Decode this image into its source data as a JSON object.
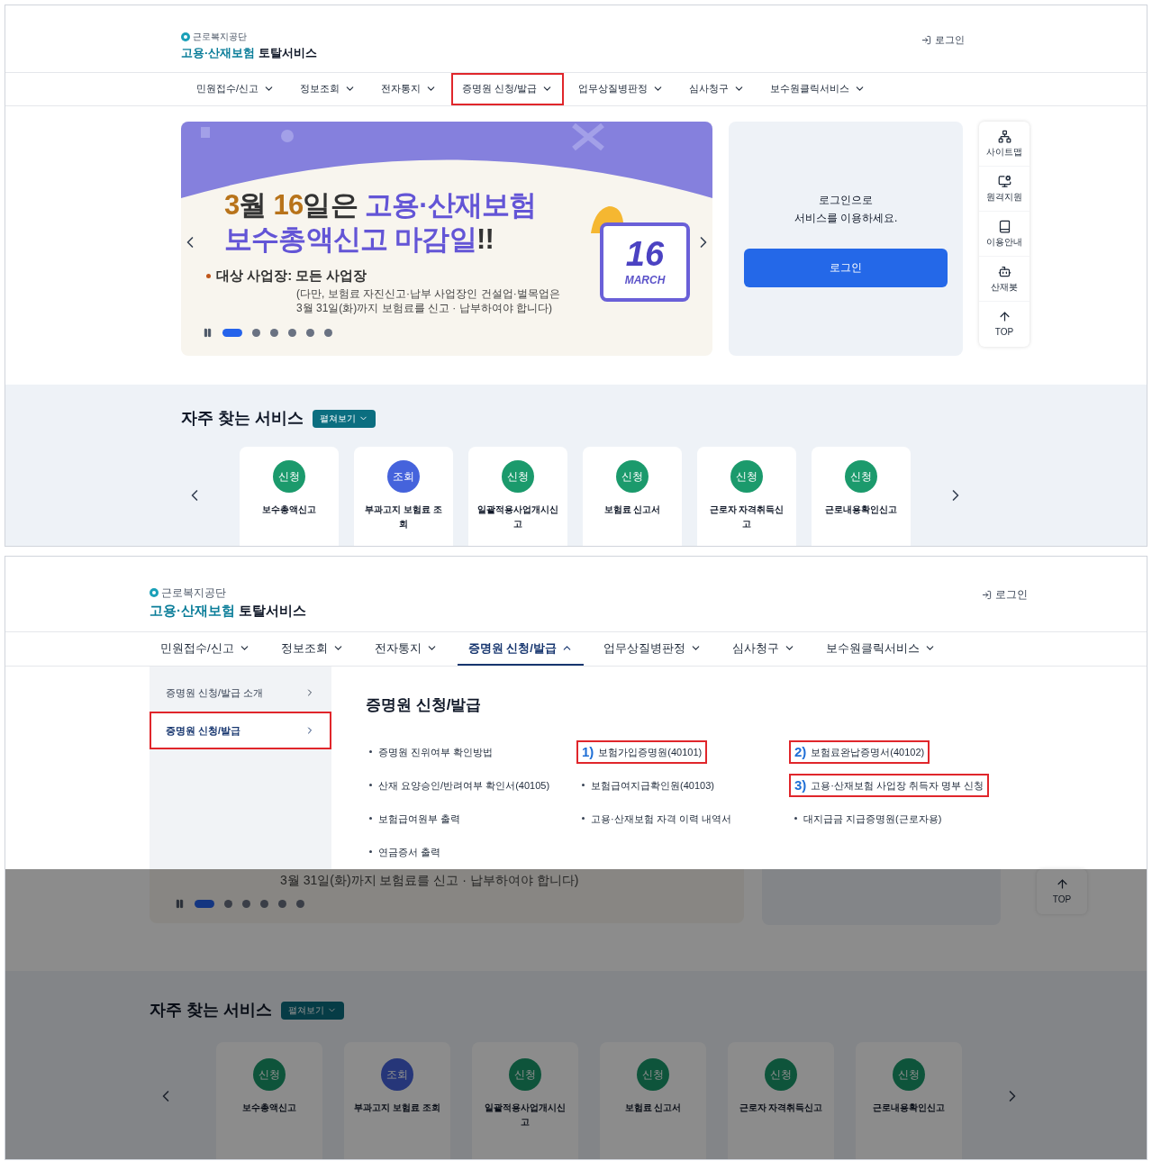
{
  "top_screenshot": {
    "header": {
      "org_name": "근로복지공단",
      "service_name_accent": "고용·산재보험",
      "service_name": "토탈서비스",
      "login_link": "로그인"
    },
    "nav": [
      {
        "label": "민원접수/신고",
        "selected": false,
        "expanded": false,
        "annotated": false
      },
      {
        "label": "정보조회",
        "selected": false,
        "expanded": false,
        "annotated": false
      },
      {
        "label": "전자통지",
        "selected": false,
        "expanded": false,
        "annotated": false
      },
      {
        "label": "증명원 신청/발급",
        "selected": false,
        "expanded": false,
        "annotated": true
      },
      {
        "label": "업무상질병판정",
        "selected": false,
        "expanded": false,
        "annotated": false
      },
      {
        "label": "심사청구",
        "selected": false,
        "expanded": false,
        "annotated": false
      },
      {
        "label": "보수원클릭서비스",
        "selected": false,
        "expanded": false,
        "annotated": false
      }
    ],
    "banner": {
      "headline": [
        [
          {
            "text": "3",
            "kind": "accent"
          },
          {
            "text": "월 ",
            "kind": "plain"
          },
          {
            "text": "16",
            "kind": "accent"
          },
          {
            "text": "일은 ",
            "kind": "plain"
          },
          {
            "text": "고용·산재보험",
            "kind": "highlight"
          }
        ],
        [
          {
            "text": "보수총액신고 마감일",
            "kind": "highlight"
          },
          {
            "text": "!!",
            "kind": "plain"
          }
        ]
      ],
      "bullet": "대상 사업장: 모든 사업장",
      "note": [
        "(다만, 보험료 자진신고·납부 사업장인 건설업·벌목업은",
        "3월 31일(화)까지 보험료를 신고 · 납부하여야 합니다)"
      ],
      "calendar_day": "16",
      "calendar_month": "MARCH",
      "dots": [
        {
          "selected": true
        },
        {
          "selected": false
        },
        {
          "selected": false
        },
        {
          "selected": false
        },
        {
          "selected": false
        },
        {
          "selected": false
        }
      ]
    },
    "login_card": {
      "message": [
        "로그인으로",
        "서비스를 이용하세요."
      ],
      "button": "로그인"
    },
    "quick_menu": [
      {
        "label": "사이트맵",
        "kind": "sitemap"
      },
      {
        "label": "원격지원",
        "kind": "remote"
      },
      {
        "label": "이용안내",
        "kind": "guide"
      },
      {
        "label": "산재봇",
        "kind": "bot"
      },
      {
        "label": "TOP",
        "kind": "top"
      }
    ],
    "services": {
      "title": "자주 찾는 서비스",
      "expand_button": "펼쳐보기",
      "cards": [
        {
          "badge": "신청",
          "kind": "apply",
          "label": "보수총액신고"
        },
        {
          "badge": "조회",
          "kind": "inquiry",
          "label": "부과고지 보험료 조회"
        },
        {
          "badge": "신청",
          "kind": "apply",
          "label": "일괄적용사업개시신고"
        },
        {
          "badge": "신청",
          "kind": "apply",
          "label": "보험료 신고서"
        },
        {
          "badge": "신청",
          "kind": "apply",
          "label": "근로자 자격취득신고"
        },
        {
          "badge": "신청",
          "kind": "apply",
          "label": "근로내용확인신고"
        }
      ]
    }
  },
  "bottom_screenshot": {
    "header": {
      "org_name": "근로복지공단",
      "service_name_accent": "고용·산재보험",
      "service_name": "토탈서비스",
      "login_link": "로그인"
    },
    "nav": [
      {
        "label": "민원접수/신고",
        "selected": false,
        "expanded": false,
        "annotated": false
      },
      {
        "label": "정보조회",
        "selected": false,
        "expanded": false,
        "annotated": false
      },
      {
        "label": "전자통지",
        "selected": false,
        "expanded": false,
        "annotated": false
      },
      {
        "label": "증명원 신청/발급",
        "selected": true,
        "expanded": true,
        "annotated": false
      },
      {
        "label": "업무상질병판정",
        "selected": false,
        "expanded": false,
        "annotated": false
      },
      {
        "label": "심사청구",
        "selected": false,
        "expanded": false,
        "annotated": false
      },
      {
        "label": "보수원클릭서비스",
        "selected": false,
        "expanded": false,
        "annotated": false
      }
    ],
    "dropdown": {
      "side_items": [
        {
          "label": "증명원 신청/발급 소개",
          "selected": false,
          "annotated": false
        },
        {
          "label": "증명원 신청/발급",
          "selected": true,
          "annotated": true
        }
      ],
      "heading": "증명원 신청/발급",
      "link_rows": [
        [
          {
            "label": "증명원 진위여부 확인방법",
            "annotated": false
          },
          {
            "number": "1)",
            "label": "보험가입증명원(40101)",
            "annotated": true
          },
          {
            "number": "2)",
            "label": "보험료완납증명서(40102)",
            "annotated": true
          }
        ],
        [
          {
            "label": "산재 요양승인/반려여부 확인서(40105)",
            "annotated": false
          },
          {
            "label": "보험급여지급확인원(40103)",
            "annotated": false
          },
          {
            "number": "3)",
            "label": "고용·산재보험 사업장 취득자 명부 신청",
            "annotated": true
          }
        ],
        [
          {
            "label": "보험급여원부 출력",
            "annotated": false
          },
          {
            "label": "고용·산재보험 자격 이력 내역서",
            "annotated": false
          },
          {
            "label": "대지급금 지급증명원(근로자용)",
            "annotated": false
          }
        ],
        [
          {
            "label": "연금증서 출력",
            "annotated": false
          }
        ]
      ]
    },
    "dimmed": {
      "banner_note": "3월 31일(화)까지 보험료를 신고 · 납부하여야 합니다)",
      "dots": [
        {
          "selected": true
        },
        {
          "selected": false
        },
        {
          "selected": false
        },
        {
          "selected": false
        },
        {
          "selected": false
        },
        {
          "selected": false
        }
      ],
      "quick_menu": [
        {
          "label": "TOP",
          "kind": "top"
        }
      ],
      "services": {
        "title": "자주 찾는 서비스",
        "expand_button": "펼쳐보기",
        "cards": [
          {
            "badge": "신청",
            "kind": "apply",
            "label": "보수총액신고"
          },
          {
            "badge": "조회",
            "kind": "inquiry",
            "label": "부과고지 보험료 조회"
          },
          {
            "badge": "신청",
            "kind": "apply",
            "label": "일괄적용사업개시신고"
          },
          {
            "badge": "신청",
            "kind": "apply",
            "label": "보험료 신고서"
          },
          {
            "badge": "신청",
            "kind": "apply",
            "label": "근로자 자격취득신고"
          },
          {
            "badge": "신청",
            "kind": "apply",
            "label": "근로내용확인신고"
          }
        ]
      }
    }
  }
}
